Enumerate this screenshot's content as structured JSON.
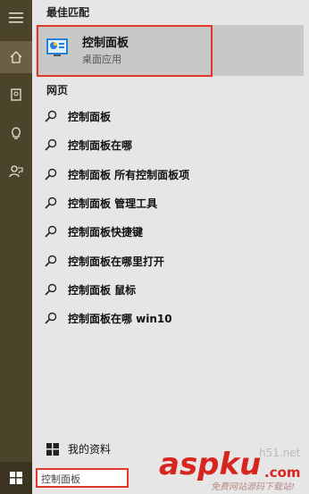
{
  "sections": {
    "best_match": "最佳匹配",
    "web": "网页"
  },
  "best_match": {
    "name": "控制面板",
    "type": "桌面应用",
    "icon": "control-panel-icon"
  },
  "web_results": [
    "控制面板",
    "控制面板在哪",
    "控制面板 所有控制面板项",
    "控制面板 管理工具",
    "控制面板快捷键",
    "控制面板在哪里打开",
    "控制面板 鼠标",
    "控制面板在哪 win10"
  ],
  "bottom": {
    "my_stuff": "我的资料"
  },
  "search": {
    "value": "控制面板"
  },
  "rail_icons": [
    "hamburger-icon",
    "home-icon",
    "notebook-icon",
    "lightbulb-icon",
    "feedback-icon"
  ],
  "watermark": {
    "host": "h51.net",
    "brand": "aspku",
    "tld": ".com",
    "sub": "免费网站源码下载站!"
  },
  "colors": {
    "rail": "#4c442a",
    "panel": "#e6e6e6",
    "highlight": "#e0392b",
    "brand": "#d7261f"
  }
}
